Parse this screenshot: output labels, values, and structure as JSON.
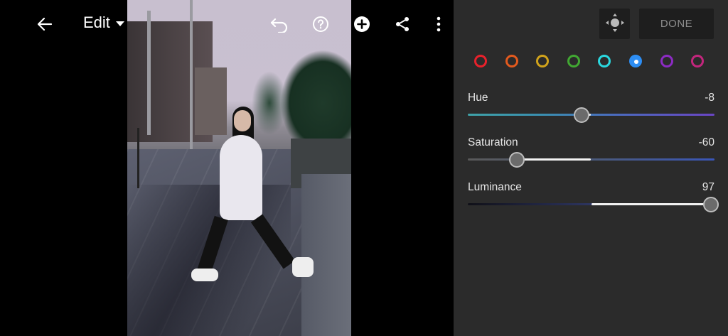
{
  "toolbar": {
    "edit_label": "Edit",
    "icons": [
      "back-arrow-icon",
      "caret-down-icon",
      "undo-icon",
      "help-icon",
      "add-icon",
      "share-icon",
      "more-vertical-icon"
    ]
  },
  "panel": {
    "target_icon": "target-adjust-icon",
    "done_label": "DONE",
    "colors": [
      {
        "name": "red",
        "hex": "#e8212b",
        "selected": false
      },
      {
        "name": "orange",
        "hex": "#e35a1e",
        "selected": false
      },
      {
        "name": "yellow",
        "hex": "#d1a31b",
        "selected": false
      },
      {
        "name": "green",
        "hex": "#41a832",
        "selected": false
      },
      {
        "name": "aqua",
        "hex": "#2ad8df",
        "selected": false
      },
      {
        "name": "blue",
        "hex": "#2d8ef4",
        "selected": true
      },
      {
        "name": "purple",
        "hex": "#8c2bc3",
        "selected": false
      },
      {
        "name": "magenta",
        "hex": "#c3267d",
        "selected": false
      }
    ],
    "sliders": [
      {
        "label": "Hue",
        "value": "-8",
        "min": -100,
        "max": 100,
        "current": -8
      },
      {
        "label": "Saturation",
        "value": "-60",
        "min": -100,
        "max": 100,
        "current": -60
      },
      {
        "label": "Luminance",
        "value": "97",
        "min": -100,
        "max": 100,
        "current": 97
      }
    ]
  }
}
